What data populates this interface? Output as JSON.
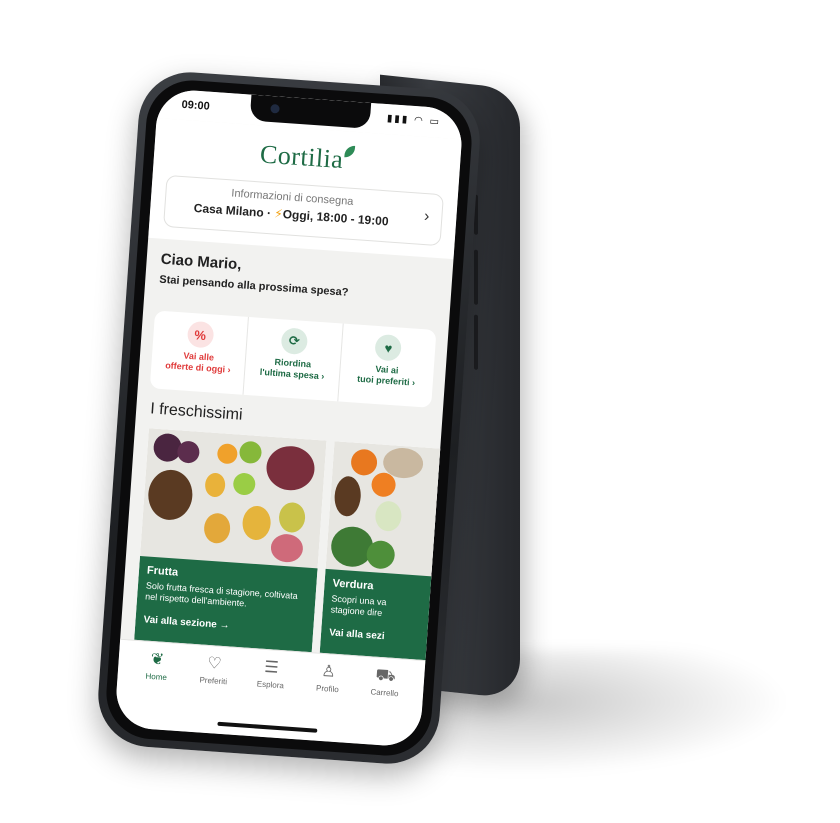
{
  "status": {
    "time": "09:00",
    "icons": "▮▮▮ ◠ ▭"
  },
  "header": {
    "logo": "Cortilia",
    "delivery_title": "Informazioni di consegna",
    "delivery_place": "Casa Milano · ",
    "delivery_bolt": "⚡",
    "delivery_time": "Oggi, 18:00 - 19:00",
    "chevron": "›"
  },
  "greeting": {
    "title": "Ciao Mario,",
    "subtitle": "Stai pensando alla prossima spesa?"
  },
  "actions": [
    {
      "icon": "%",
      "label1": "Vai alle",
      "label2": "offerte di oggi ›"
    },
    {
      "icon": "⟳",
      "label1": "Riordina",
      "label2": "l'ultima spesa ›"
    },
    {
      "icon": "♥",
      "label1": "Vai ai",
      "label2": "tuoi preferiti ›"
    }
  ],
  "section": {
    "title": "I freschissimi"
  },
  "cards": [
    {
      "title": "Frutta",
      "desc": "Solo frutta fresca di stagione, coltivata nel rispetto dell'ambiente.",
      "link": "Vai alla sezione  →"
    },
    {
      "title": "Verdura",
      "desc": "Scopri una va stagione dire",
      "link": "Vai alla sezi"
    }
  ],
  "nav": [
    {
      "icon": "❦",
      "label": "Home"
    },
    {
      "icon": "♡",
      "label": "Preferiti"
    },
    {
      "icon": "☰",
      "label": "Esplora"
    },
    {
      "icon": "♙",
      "label": "Profilo"
    },
    {
      "icon": "⛟",
      "label": "Carrello"
    }
  ],
  "colors": {
    "brand": "#1e6b45",
    "offer": "#e03b3b",
    "bolt": "#f2a316"
  }
}
